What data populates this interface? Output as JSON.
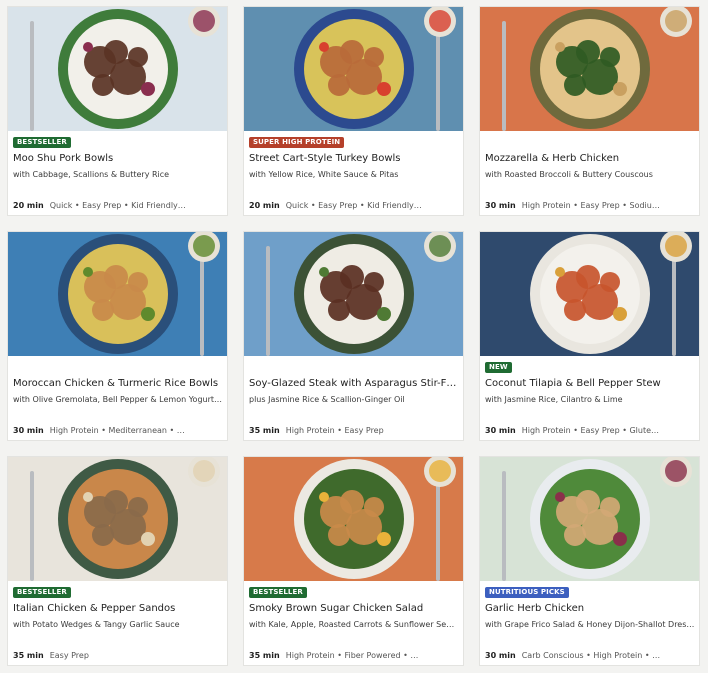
{
  "colors": {
    "bestseller": "#1f6b32",
    "super_high_protein": "#b5402a",
    "new": "#1f6b32",
    "nutritious_picks": "#3c5fbf"
  },
  "cards": [
    {
      "badge": "BESTSELLER",
      "badge_type": "bestseller",
      "title": "Moo Shu Pork Bowls",
      "subtitle": "with Cabbage, Scallions & Buttery Rice",
      "time": "20 min",
      "tags": "Quick • Easy Prep • Kid Friendly…",
      "bg": "#d9e3ea",
      "plate": "#3f7c3b",
      "base": "#f2f0ea",
      "topping": "#5a3324",
      "accent": "#8a2e4f"
    },
    {
      "badge": "SUPER HIGH PROTEIN",
      "badge_type": "super_high_protein",
      "title": "Street Cart-Style Turkey Bowls",
      "subtitle": "with Yellow Rice, White Sauce & Pitas",
      "time": "20 min",
      "tags": "Quick • Easy Prep • Kid Friendly…",
      "bg": "#5f8fb0",
      "plate": "#2c4a8f",
      "base": "#d8c35a",
      "topping": "#b86a3a",
      "accent": "#d8402e"
    },
    {
      "badge": "",
      "badge_type": "none",
      "title": "Mozzarella & Herb Chicken",
      "subtitle": "with Roasted Broccoli & Buttery Couscous",
      "time": "30 min",
      "tags": "High Protein • Easy Prep • Sodiu…",
      "bg": "#d8754a",
      "plate": "#6f6a3d",
      "base": "#e3c48a",
      "topping": "#2f5a23",
      "accent": "#c9a060"
    },
    {
      "badge": "",
      "badge_type": "none",
      "title": "Moroccan Chicken & Turmeric Rice Bowls",
      "subtitle": "with Olive Gremolata, Bell Pepper & Lemon Yogurt …",
      "time": "30 min",
      "tags": "High Protein • Mediterranean • …",
      "bg": "#3e7fb5",
      "plate": "#2a4f7a",
      "base": "#d9c05a",
      "topping": "#c98a4a",
      "accent": "#5f8a2c"
    },
    {
      "badge": "",
      "badge_type": "none",
      "title": "Soy-Glazed Steak with Asparagus Stir-F…",
      "subtitle": "plus Jasmine Rice & Scallion-Ginger Oil",
      "time": "35 min",
      "tags": "High Protein • Easy Prep",
      "bg": "#6f9fc9",
      "plate": "#3c5236",
      "base": "#efece4",
      "topping": "#5a2f22",
      "accent": "#4f7a34"
    },
    {
      "badge": "NEW",
      "badge_type": "new",
      "title": "Coconut Tilapia & Bell Pepper Stew",
      "subtitle": "with Jasmine Rice, Cilantro & Lime",
      "time": "30 min",
      "tags": "High Protein • Easy Prep • Glute…",
      "bg": "#2f4a6d",
      "plate": "#e9e6df",
      "base": "#f3f1ec",
      "topping": "#c8552c",
      "accent": "#d9a03a"
    },
    {
      "badge": "BESTSELLER",
      "badge_type": "bestseller",
      "title": "Italian Chicken & Pepper Sandos",
      "subtitle": "with Potato Wedges & Tangy Garlic Sauce",
      "time": "35 min",
      "tags": "Easy Prep",
      "bg": "#e8e4dc",
      "plate": "#3f5a45",
      "base": "#c9874a",
      "topping": "#8a6a4a",
      "accent": "#e2d2b2"
    },
    {
      "badge": "BESTSELLER",
      "badge_type": "bestseller",
      "title": "Smoky Brown Sugar Chicken Salad",
      "subtitle": "with Kale, Apple, Roasted Carrots & Sunflower Seeds",
      "time": "35 min",
      "tags": "High Protein • Fiber Powered • …",
      "bg": "#d77a4a",
      "plate": "#ece9e2",
      "base": "#3f6a2c",
      "topping": "#c98a4a",
      "accent": "#e9b23a"
    },
    {
      "badge": "NUTRITIOUS PICKS",
      "badge_type": "nutritious_picks",
      "title": "Garlic Herb Chicken",
      "subtitle": "with Grape Frico Salad & Honey Dijon-Shallot Dressi…",
      "time": "30 min",
      "tags": "Carb Conscious • High Protein • …",
      "bg": "#d7e3d6",
      "plate": "#e9ecef",
      "base": "#4f8a3a",
      "topping": "#d3a875",
      "accent": "#8a2f4a"
    }
  ]
}
